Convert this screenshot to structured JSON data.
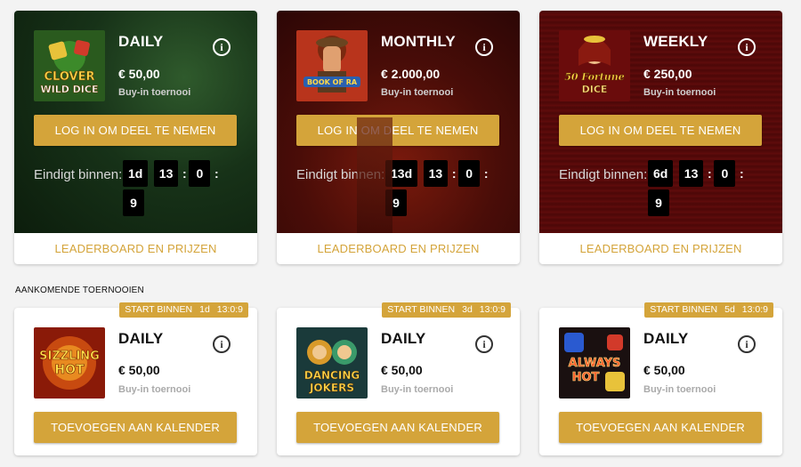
{
  "tournaments": [
    {
      "title": "DAILY",
      "amount": "€ 50,00",
      "subtitle": "Buy-in toernooi",
      "button": "LOG IN OM DEEL TE NEMEN",
      "ends_label": "Eindigt binnen:",
      "timer": {
        "days": "1d",
        "hours": "13",
        "minutes": "0",
        "seconds": "9"
      },
      "leaderboard": "LEADERBOARD EN PRIJZEN",
      "game_name": "Wild Clover Dice",
      "game_icon": "wild-clover-dice-thumbnail"
    },
    {
      "title": "MONTHLY",
      "amount": "€ 2.000,00",
      "subtitle": "Buy-in toernooi",
      "button": "LOG IN OM DEEL TE NEMEN",
      "ends_label": "Eindigt binnen:",
      "timer": {
        "days": "13d",
        "hours": "13",
        "minutes": "0",
        "seconds": "9"
      },
      "leaderboard": "LEADERBOARD EN PRIJZEN",
      "game_name": "Book of Ra",
      "game_icon": "book-of-ra-thumbnail"
    },
    {
      "title": "WEEKLY",
      "amount": "€ 250,00",
      "subtitle": "Buy-in toernooi",
      "button": "LOG IN OM DEEL TE NEMEN",
      "ends_label": "Eindigt binnen:",
      "timer": {
        "days": "6d",
        "hours": "13",
        "minutes": "0",
        "seconds": "9"
      },
      "leaderboard": "LEADERBOARD EN PRIJZEN",
      "game_name": "50 Fortune Dice",
      "game_icon": "fortune-dice-thumbnail"
    }
  ],
  "upcoming_label": "AANKOMENDE TOERNOOIEN",
  "upcoming": [
    {
      "badge_label": "START BINNEN",
      "badge_days": "1d",
      "badge_time": "13:0:9",
      "title": "DAILY",
      "amount": "€ 50,00",
      "subtitle": "Buy-in toernooi",
      "button": "TOEVOEGEN AAN KALENDER",
      "game_name": "Sizzling Hot",
      "game_icon": "sizzling-hot-thumbnail"
    },
    {
      "badge_label": "START BINNEN",
      "badge_days": "3d",
      "badge_time": "13:0:9",
      "title": "DAILY",
      "amount": "€ 50,00",
      "subtitle": "Buy-in toernooi",
      "button": "TOEVOEGEN AAN KALENDER",
      "game_name": "Dancing Jokers",
      "game_icon": "dancing-jokers-thumbnail"
    },
    {
      "badge_label": "START BINNEN",
      "badge_days": "5d",
      "badge_time": "13:0:9",
      "title": "DAILY",
      "amount": "€ 50,00",
      "subtitle": "Buy-in toernooi",
      "button": "TOEVOEGEN AAN KALENDER",
      "game_name": "Always Hot Cubes",
      "game_icon": "always-hot-cubes-thumbnail"
    }
  ],
  "colors": {
    "accent": "#d4a43a",
    "card": "#ffffff",
    "background": "#f3f3f3"
  }
}
